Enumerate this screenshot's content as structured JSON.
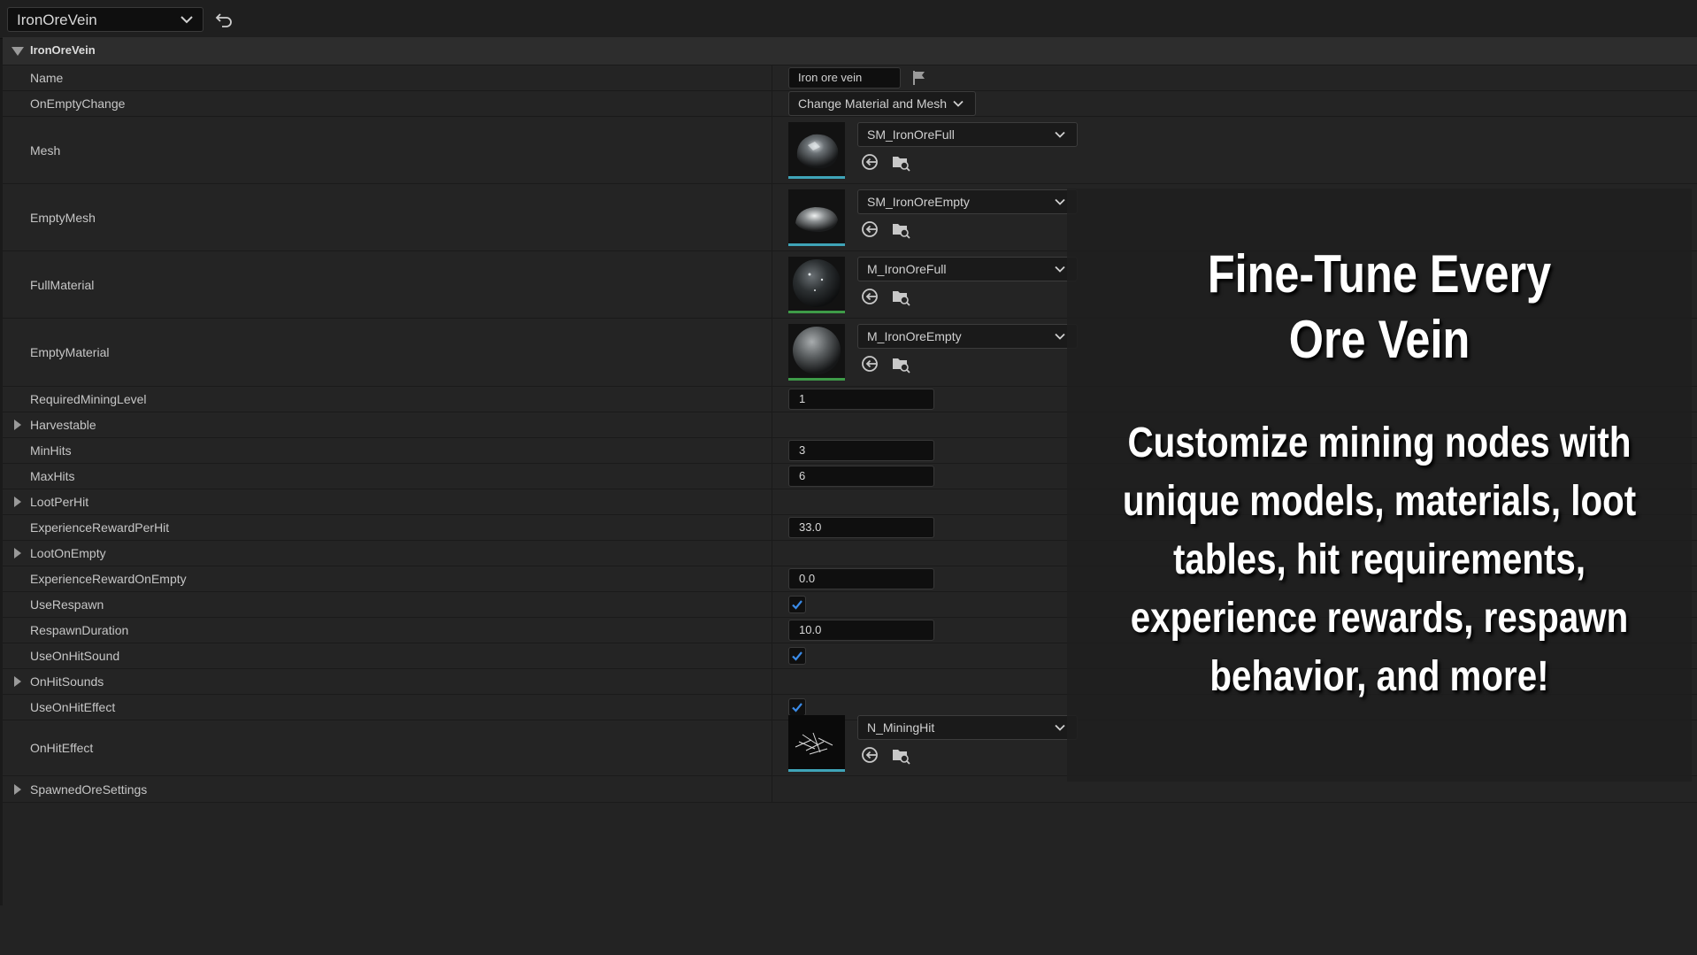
{
  "toolbar": {
    "asset_name": "IronOreVein",
    "icons": {
      "dropdown": "chevron-down-icon",
      "back": "back-arrow-icon"
    }
  },
  "category": {
    "label": "IronOreVein"
  },
  "properties": {
    "name": {
      "label": "Name",
      "value": "Iron ore vein"
    },
    "on_empty_change": {
      "label": "OnEmptyChange",
      "value": "Change Material and Mesh"
    },
    "mesh": {
      "label": "Mesh",
      "asset": "SM_IronOreFull"
    },
    "empty_mesh": {
      "label": "EmptyMesh",
      "asset": "SM_IronOreEmpty"
    },
    "full_material": {
      "label": "FullMaterial",
      "asset": "M_IronOreFull"
    },
    "empty_material": {
      "label": "EmptyMaterial",
      "asset": "M_IronOreEmpty"
    },
    "required_mining_level": {
      "label": "RequiredMiningLevel",
      "value": "1"
    },
    "harvestable": {
      "label": "Harvestable"
    },
    "min_hits": {
      "label": "MinHits",
      "value": "3"
    },
    "max_hits": {
      "label": "MaxHits",
      "value": "6"
    },
    "loot_per_hit": {
      "label": "LootPerHit"
    },
    "experience_reward_per_hit": {
      "label": "ExperienceRewardPerHit",
      "value": "33.0"
    },
    "loot_on_empty": {
      "label": "LootOnEmpty"
    },
    "experience_reward_on_empty": {
      "label": "ExperienceRewardOnEmpty",
      "value": "0.0"
    },
    "use_respawn": {
      "label": "UseRespawn",
      "checked": true
    },
    "respawn_duration": {
      "label": "RespawnDuration",
      "value": "10.0"
    },
    "use_on_hit_sound": {
      "label": "UseOnHitSound",
      "checked": true
    },
    "on_hit_sounds": {
      "label": "OnHitSounds"
    },
    "use_on_hit_effect": {
      "label": "UseOnHitEffect",
      "checked": true
    },
    "on_hit_effect": {
      "label": "OnHitEffect",
      "asset": "N_MiningHit"
    },
    "spawned_ore_settings": {
      "label": "SpawnedOreSettings"
    }
  },
  "overlay": {
    "headline_line1": "Fine-Tune Every",
    "headline_line2": "Ore Vein",
    "body_lines": [
      "Customize mining nodes with",
      "unique models, materials, loot",
      "tables, hit requirements,",
      "experience rewards, respawn",
      "behavior, and more!"
    ]
  },
  "colors": {
    "panel_bg": "#232323",
    "category_bg": "#2d2d2d",
    "input_bg": "#0f0f0f",
    "checkbox_accent": "#2f7fd6",
    "mesh_thumb_underline": "#3fa4b8",
    "material_thumb_underline": "#3e9b48"
  }
}
